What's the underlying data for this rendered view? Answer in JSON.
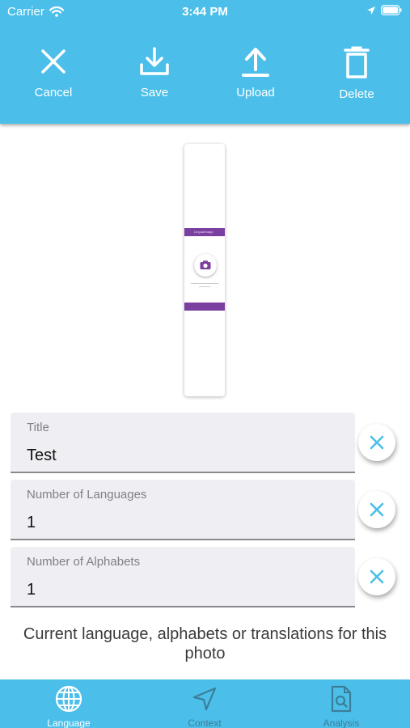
{
  "status_bar": {
    "carrier": "Carrier",
    "time": "3:44 PM"
  },
  "toolbar": {
    "cancel_label": "Cancel",
    "save_label": "Save",
    "upload_label": "Upload",
    "delete_label": "Delete"
  },
  "preview": {
    "app_name": "LinguaSnapp"
  },
  "form": {
    "fields": [
      {
        "label": "Title",
        "value": "Test"
      },
      {
        "label": "Number of Languages",
        "value": "1"
      },
      {
        "label": "Number of Alphabets",
        "value": "1"
      }
    ]
  },
  "helper_text": "Current language, alphabets or translations for this photo",
  "tabs": [
    {
      "label": "Language",
      "icon": "globe-icon",
      "active": true
    },
    {
      "label": "Context",
      "icon": "location-arrow-icon",
      "active": false
    },
    {
      "label": "Analysis",
      "icon": "document-search-icon",
      "active": false
    }
  ],
  "colors": {
    "accent": "#4bbfe9",
    "icon_blue": "#4bbfe9",
    "inactive_tab": "#3b7e9a"
  }
}
